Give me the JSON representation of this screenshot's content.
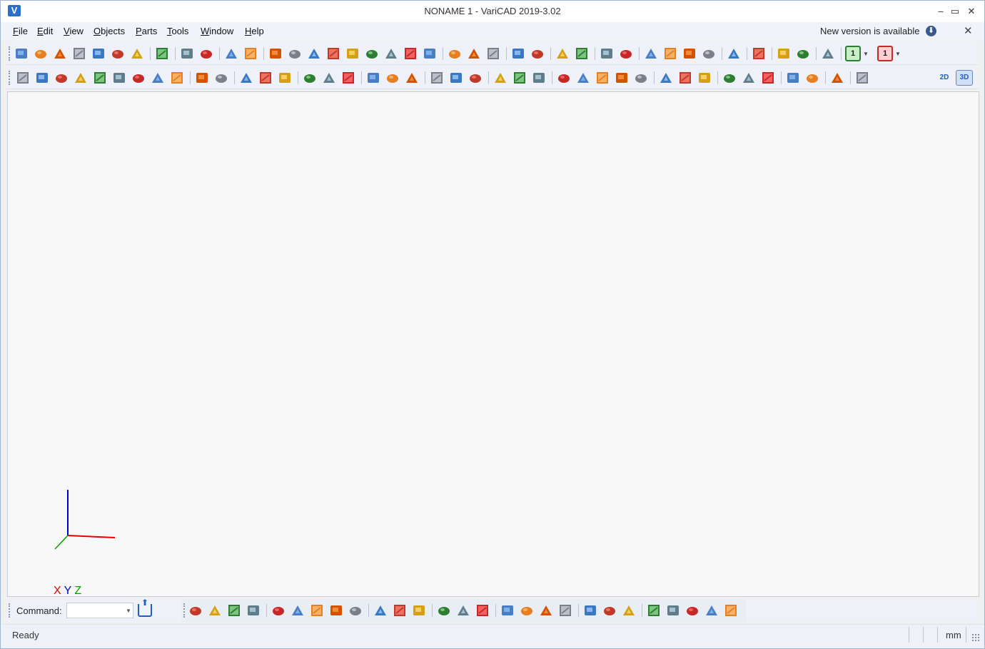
{
  "window": {
    "title": "NONAME 1 - VariCAD 2019-3.02",
    "app_icon_letter": "V"
  },
  "menu": {
    "items": [
      {
        "label": "File",
        "mnemonic": "F",
        "rest": "ile"
      },
      {
        "label": "Edit",
        "mnemonic": "E",
        "rest": "dit"
      },
      {
        "label": "View",
        "mnemonic": "V",
        "rest": "iew"
      },
      {
        "label": "Objects",
        "mnemonic": "O",
        "rest": "bjects"
      },
      {
        "label": "Parts",
        "mnemonic": "P",
        "rest": "arts"
      },
      {
        "label": "Tools",
        "mnemonic": "T",
        "rest": "ools"
      },
      {
        "label": "Window",
        "mnemonic": "W",
        "rest": "indow"
      },
      {
        "label": "Help",
        "mnemonic": "H",
        "rest": "elp"
      }
    ],
    "new_version": "New version is available"
  },
  "toolbar1": {
    "icons": [
      "new-file",
      "open-file",
      "open-recent",
      "import-file",
      "save-file",
      "save-all",
      "save-as",
      "print",
      "copy",
      "paste",
      "undo",
      "redo",
      "box-solid",
      "cylinder-solid",
      "cone-solid",
      "truncated-cone",
      "tube-solid",
      "pyramid-solid",
      "elbow-solid",
      "torus-solid",
      "sphere-solid",
      "bolt-part",
      "nut-part",
      "spring-part",
      "extrude-profile",
      "structure-part",
      "view-iso",
      "view-set",
      "move-solid",
      "transform-solid",
      "query-v",
      "query-s",
      "query-s2",
      "query-j",
      "eraser",
      "measure",
      "zoom-in",
      "zoom-all",
      "cube-render",
      "screen-1",
      "screen-1-red"
    ],
    "screen_labels": [
      "1",
      "1"
    ]
  },
  "toolbar2": {
    "icons": [
      "insert-point",
      "delete-object",
      "edit-object",
      "move-object",
      "mirror-object",
      "text-object",
      "anchor-object",
      "multi-anchor",
      "select-cross",
      "box-wire",
      "box-outline",
      "color-palette",
      "shade-mode",
      "gray-solid",
      "drill-tool",
      "thread-tool",
      "weld-tool",
      "fillet-red",
      "chamfer-tool",
      "bool-add",
      "bool-sub",
      "bool-cut",
      "align-right",
      "align-left",
      "align-cross",
      "copy-view",
      "solid-query",
      "solid-move",
      "rotate-solid",
      "scale-solid",
      "line-measure",
      "angle-measure",
      "edge-pick",
      "face-pick",
      "axis-xyz",
      "frame-xyz",
      "arrow-xyz",
      "display-3d",
      "hide-3d",
      "edit-colors",
      "crash-test"
    ],
    "view_2d": "2D",
    "view_3d": "3D"
  },
  "axes": {
    "x": "X",
    "y": "Y",
    "z": "Z",
    "x_color": "#e60000",
    "y_color": "#0000c8",
    "z_color": "#00a000"
  },
  "command": {
    "label": "Command:",
    "value": ""
  },
  "cmd_tools": {
    "icons": [
      "solid-box",
      "sweep-tube",
      "pipe-bend",
      "text-a",
      "layers-list",
      "group-arrows",
      "move-arrows",
      "copy-items",
      "water-drop",
      "tree-red",
      "stack-red",
      "stack-blue",
      "open-folder",
      "branch-folder",
      "rotate-disk",
      "insert-yellow",
      "insert-up",
      "insert-delete",
      "insert-move",
      "table-add",
      "table-up",
      "table-delete",
      "check-pass",
      "check-fail",
      "error-x",
      "error-orange",
      "error-red"
    ]
  },
  "status": {
    "text": "Ready",
    "unit": "mm"
  },
  "colors": {
    "accent": "#1f5fbf",
    "toolbar_bg": "#eef2f8",
    "canvas_bg": "#f8f8f8"
  }
}
